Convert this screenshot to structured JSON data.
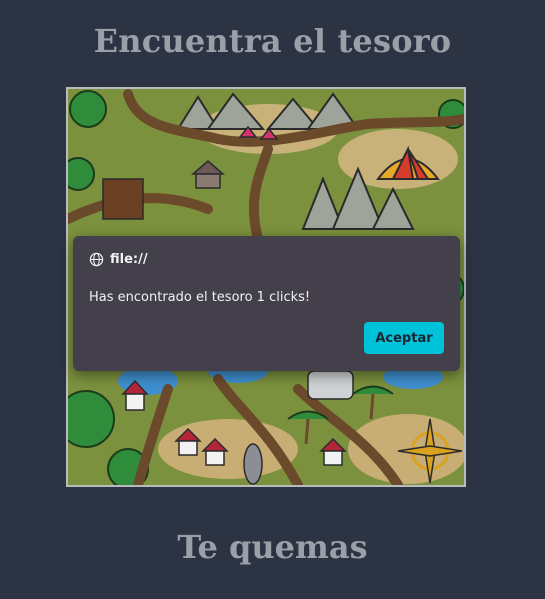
{
  "page": {
    "title": "Encuentra el tesoro",
    "status_text": "Te quemas"
  },
  "dialog": {
    "origin": "file://",
    "message": "Has encontrado el tesoro 1 clicks!",
    "accept_label": "Aceptar",
    "accent_color": "#00c2d8"
  },
  "map": {
    "icon": "treasure-map",
    "elements": [
      "forest",
      "mountains",
      "tents",
      "circus-tent",
      "huts",
      "palms",
      "compass-rose",
      "paths",
      "stadium"
    ]
  }
}
